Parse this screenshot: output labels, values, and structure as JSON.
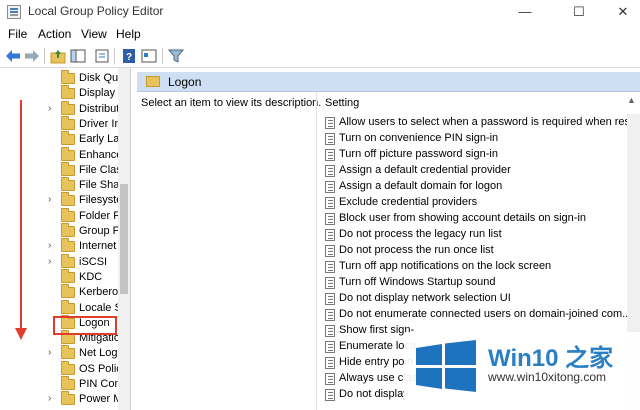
{
  "window": {
    "title": "Local Group Policy Editor"
  },
  "window_controls": {
    "minimize": "—",
    "maximize": "☐",
    "close": "✕"
  },
  "menu": [
    "File",
    "Action",
    "View",
    "Help"
  ],
  "tree": {
    "items": [
      {
        "label": "Disk Quo",
        "expandable": false
      },
      {
        "label": "Display",
        "expandable": false
      },
      {
        "label": "Distribut",
        "expandable": true
      },
      {
        "label": "Driver In",
        "expandable": false
      },
      {
        "label": "Early Lau",
        "expandable": false
      },
      {
        "label": "Enhance",
        "expandable": false
      },
      {
        "label": "File Clas",
        "expandable": false
      },
      {
        "label": "File Shar",
        "expandable": false
      },
      {
        "label": "Filesyste",
        "expandable": true
      },
      {
        "label": "Folder R",
        "expandable": false
      },
      {
        "label": "Group P",
        "expandable": false
      },
      {
        "label": "Internet",
        "expandable": true
      },
      {
        "label": "iSCSI",
        "expandable": true
      },
      {
        "label": "KDC",
        "expandable": false
      },
      {
        "label": "Kerberos",
        "expandable": false
      },
      {
        "label": "Locale S",
        "expandable": false
      },
      {
        "label": "Logon",
        "expandable": false,
        "selected": true
      },
      {
        "label": "Mitigatio",
        "expandable": false
      },
      {
        "label": "Net Logo",
        "expandable": true
      },
      {
        "label": "OS Polic",
        "expandable": false
      },
      {
        "label": "PIN Com",
        "expandable": false
      },
      {
        "label": "Power M",
        "expandable": true
      }
    ]
  },
  "details": {
    "header": "Logon",
    "description": "Select an item to view its description.",
    "column": "Setting",
    "settings": [
      "Allow users to select when a password is required when resu...",
      "Turn on convenience PIN sign-in",
      "Turn off picture password sign-in",
      "Assign a default credential provider",
      "Assign a default domain for logon",
      "Exclude credential providers",
      "Block user from showing account details on sign-in",
      "Do not process the legacy run list",
      "Do not process the run once list",
      "Turn off app notifications on the lock screen",
      "Turn off Windows Startup sound",
      "Do not display network selection UI",
      "Do not enumerate connected users on domain-joined com...",
      "Show first sign-",
      "Enumerate loca",
      "Hide entry poin",
      "Always use clas",
      "Do not display"
    ]
  },
  "watermark": {
    "brand": "Win10 之家",
    "url": "www.win10xitong.com"
  },
  "colors": {
    "annotation_red": "#e23c2c",
    "header_band": "#cfdff3",
    "brand_blue": "#2a7fc4"
  }
}
